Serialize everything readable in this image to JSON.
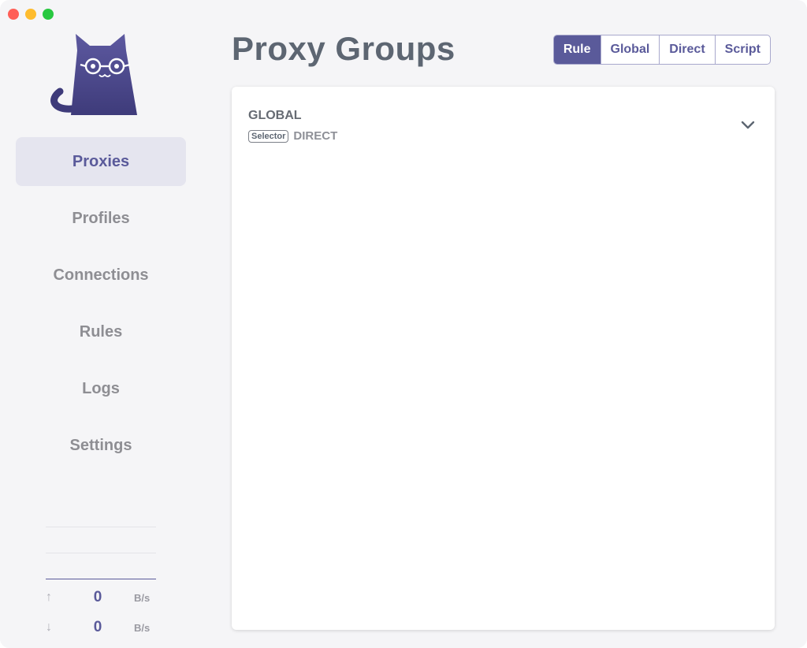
{
  "sidebar": {
    "items": [
      {
        "label": "Proxies",
        "active": true
      },
      {
        "label": "Profiles",
        "active": false
      },
      {
        "label": "Connections",
        "active": false
      },
      {
        "label": "Rules",
        "active": false
      },
      {
        "label": "Logs",
        "active": false
      },
      {
        "label": "Settings",
        "active": false
      }
    ],
    "traffic": {
      "upload": {
        "value": "0",
        "unit": "B/s",
        "icon": "arrow-up-icon"
      },
      "download": {
        "value": "0",
        "unit": "B/s",
        "icon": "arrow-down-icon"
      }
    }
  },
  "header": {
    "title": "Proxy Groups",
    "modes": [
      {
        "label": "Rule",
        "active": true
      },
      {
        "label": "Global",
        "active": false
      },
      {
        "label": "Direct",
        "active": false
      },
      {
        "label": "Script",
        "active": false
      }
    ]
  },
  "groups": [
    {
      "name": "GLOBAL",
      "type": "Selector",
      "now": "DIRECT",
      "icon": "chevron-down-icon"
    }
  ],
  "colors": {
    "accent": "#5a5a9a",
    "active_nav_bg": "#e5e5ef",
    "title": "#5d6672"
  }
}
